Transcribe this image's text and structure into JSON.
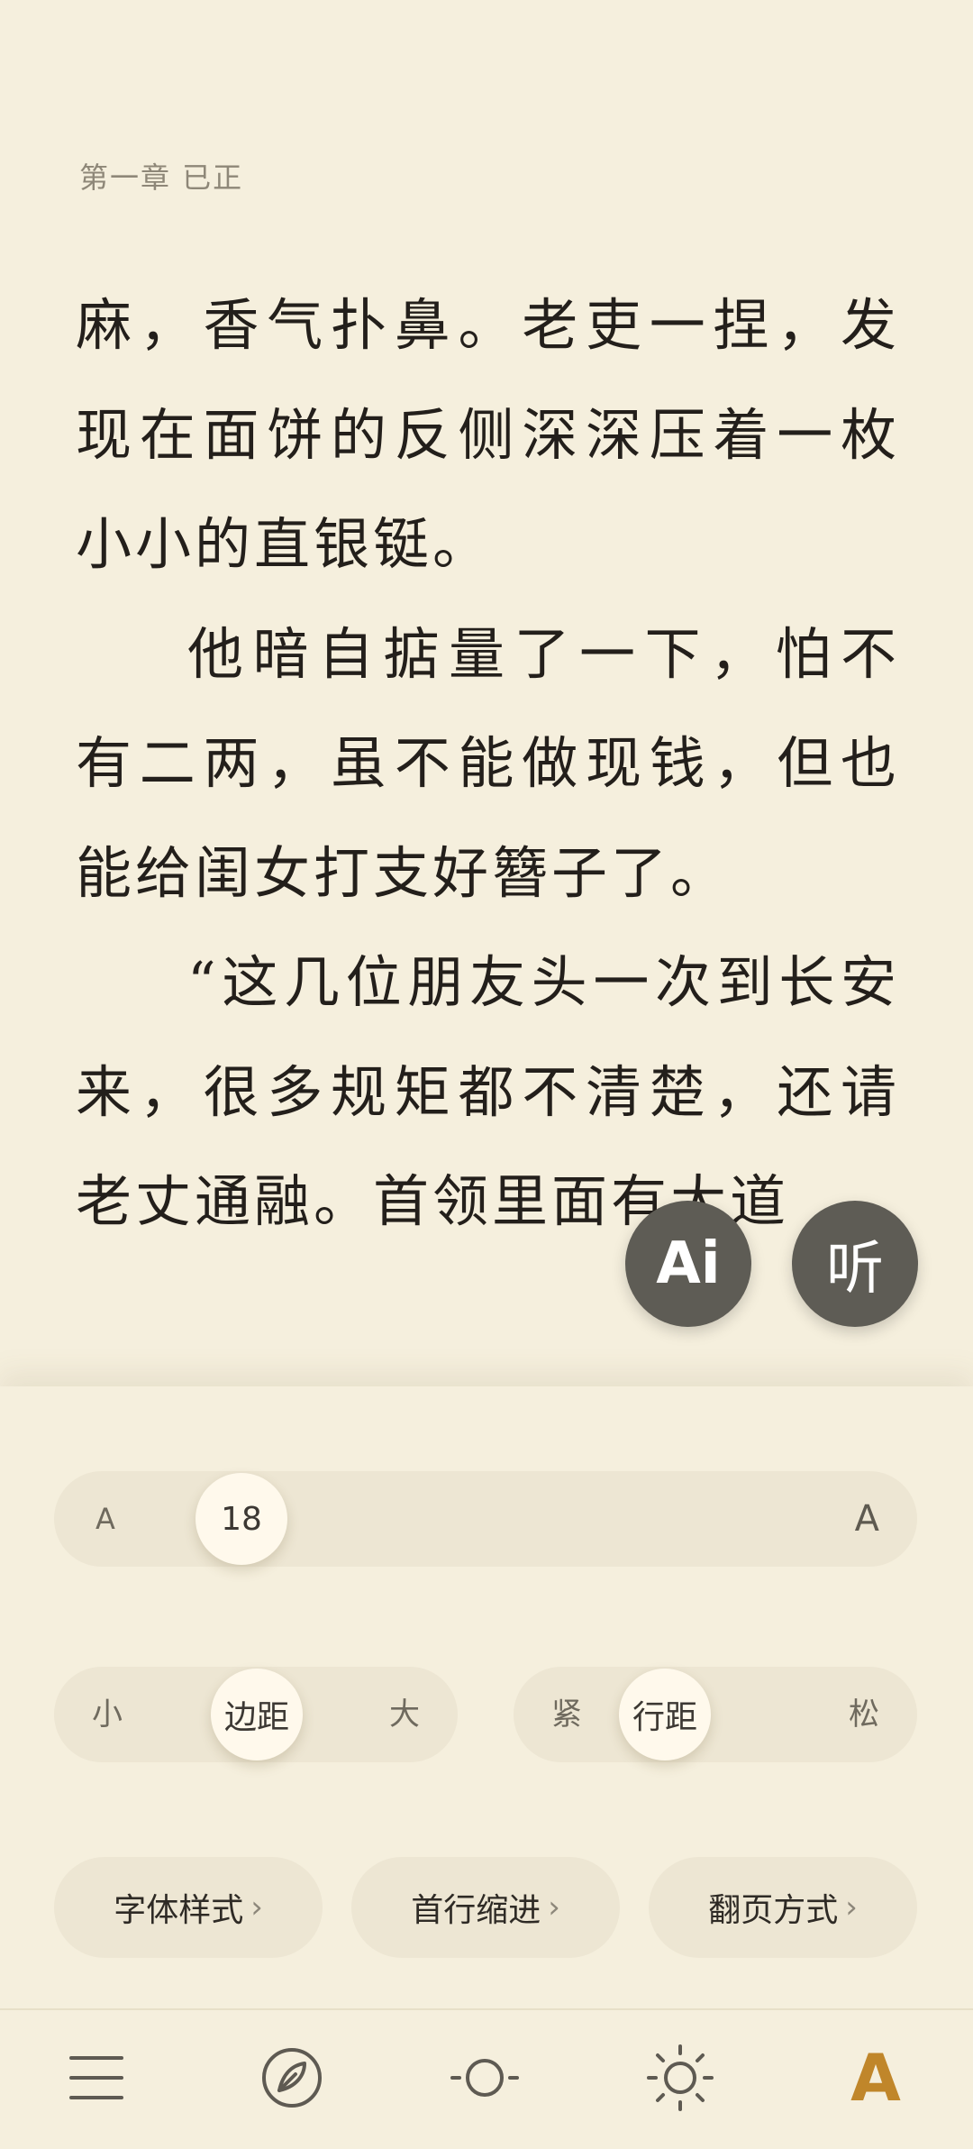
{
  "reader": {
    "chapter_title": "第一章  已正",
    "paragraphs": [
      {
        "indent": false,
        "text": "麻，香气扑鼻。老吏一捏，发现在面饼的反侧深深压着一枚小小的直银铤。"
      },
      {
        "indent": true,
        "text": "他暗自掂量了一下，怕不有二两，虽不能做现钱，但也能给闺女打支好簪子了。"
      },
      {
        "indent": true,
        "text": "“这几位朋友头一次到长安来，很多规矩都不清楚，还请老丈通融。首领里面有大道"
      }
    ]
  },
  "fab": {
    "ai_label": "Ai",
    "listen_label": "听"
  },
  "settings": {
    "font_size": {
      "small_label": "A",
      "large_label": "A",
      "value": "18",
      "level": 0.0
    },
    "margin": {
      "left_label": "小",
      "knob_label": "边距",
      "right_label": "大",
      "level": 0.5
    },
    "line_spacing": {
      "left_label": "紧",
      "knob_label": "行距",
      "right_label": "松",
      "level": 0.33
    },
    "options": [
      {
        "label": "字体样式",
        "chevron": "›"
      },
      {
        "label": "首行缩进",
        "chevron": "›"
      },
      {
        "label": "翻页方式",
        "chevron": "›"
      }
    ]
  },
  "nav": {
    "items": [
      {
        "icon": "menu-icon"
      },
      {
        "icon": "compass-icon"
      },
      {
        "icon": "night-mode-icon"
      },
      {
        "icon": "brightness-icon"
      },
      {
        "icon": "font-settings-icon",
        "label": "A",
        "active": true
      }
    ],
    "accent_color": "#C0862A"
  },
  "colors": {
    "background": "#F5EFDD",
    "text": "#231F1B",
    "fab": "#5E5C55"
  }
}
